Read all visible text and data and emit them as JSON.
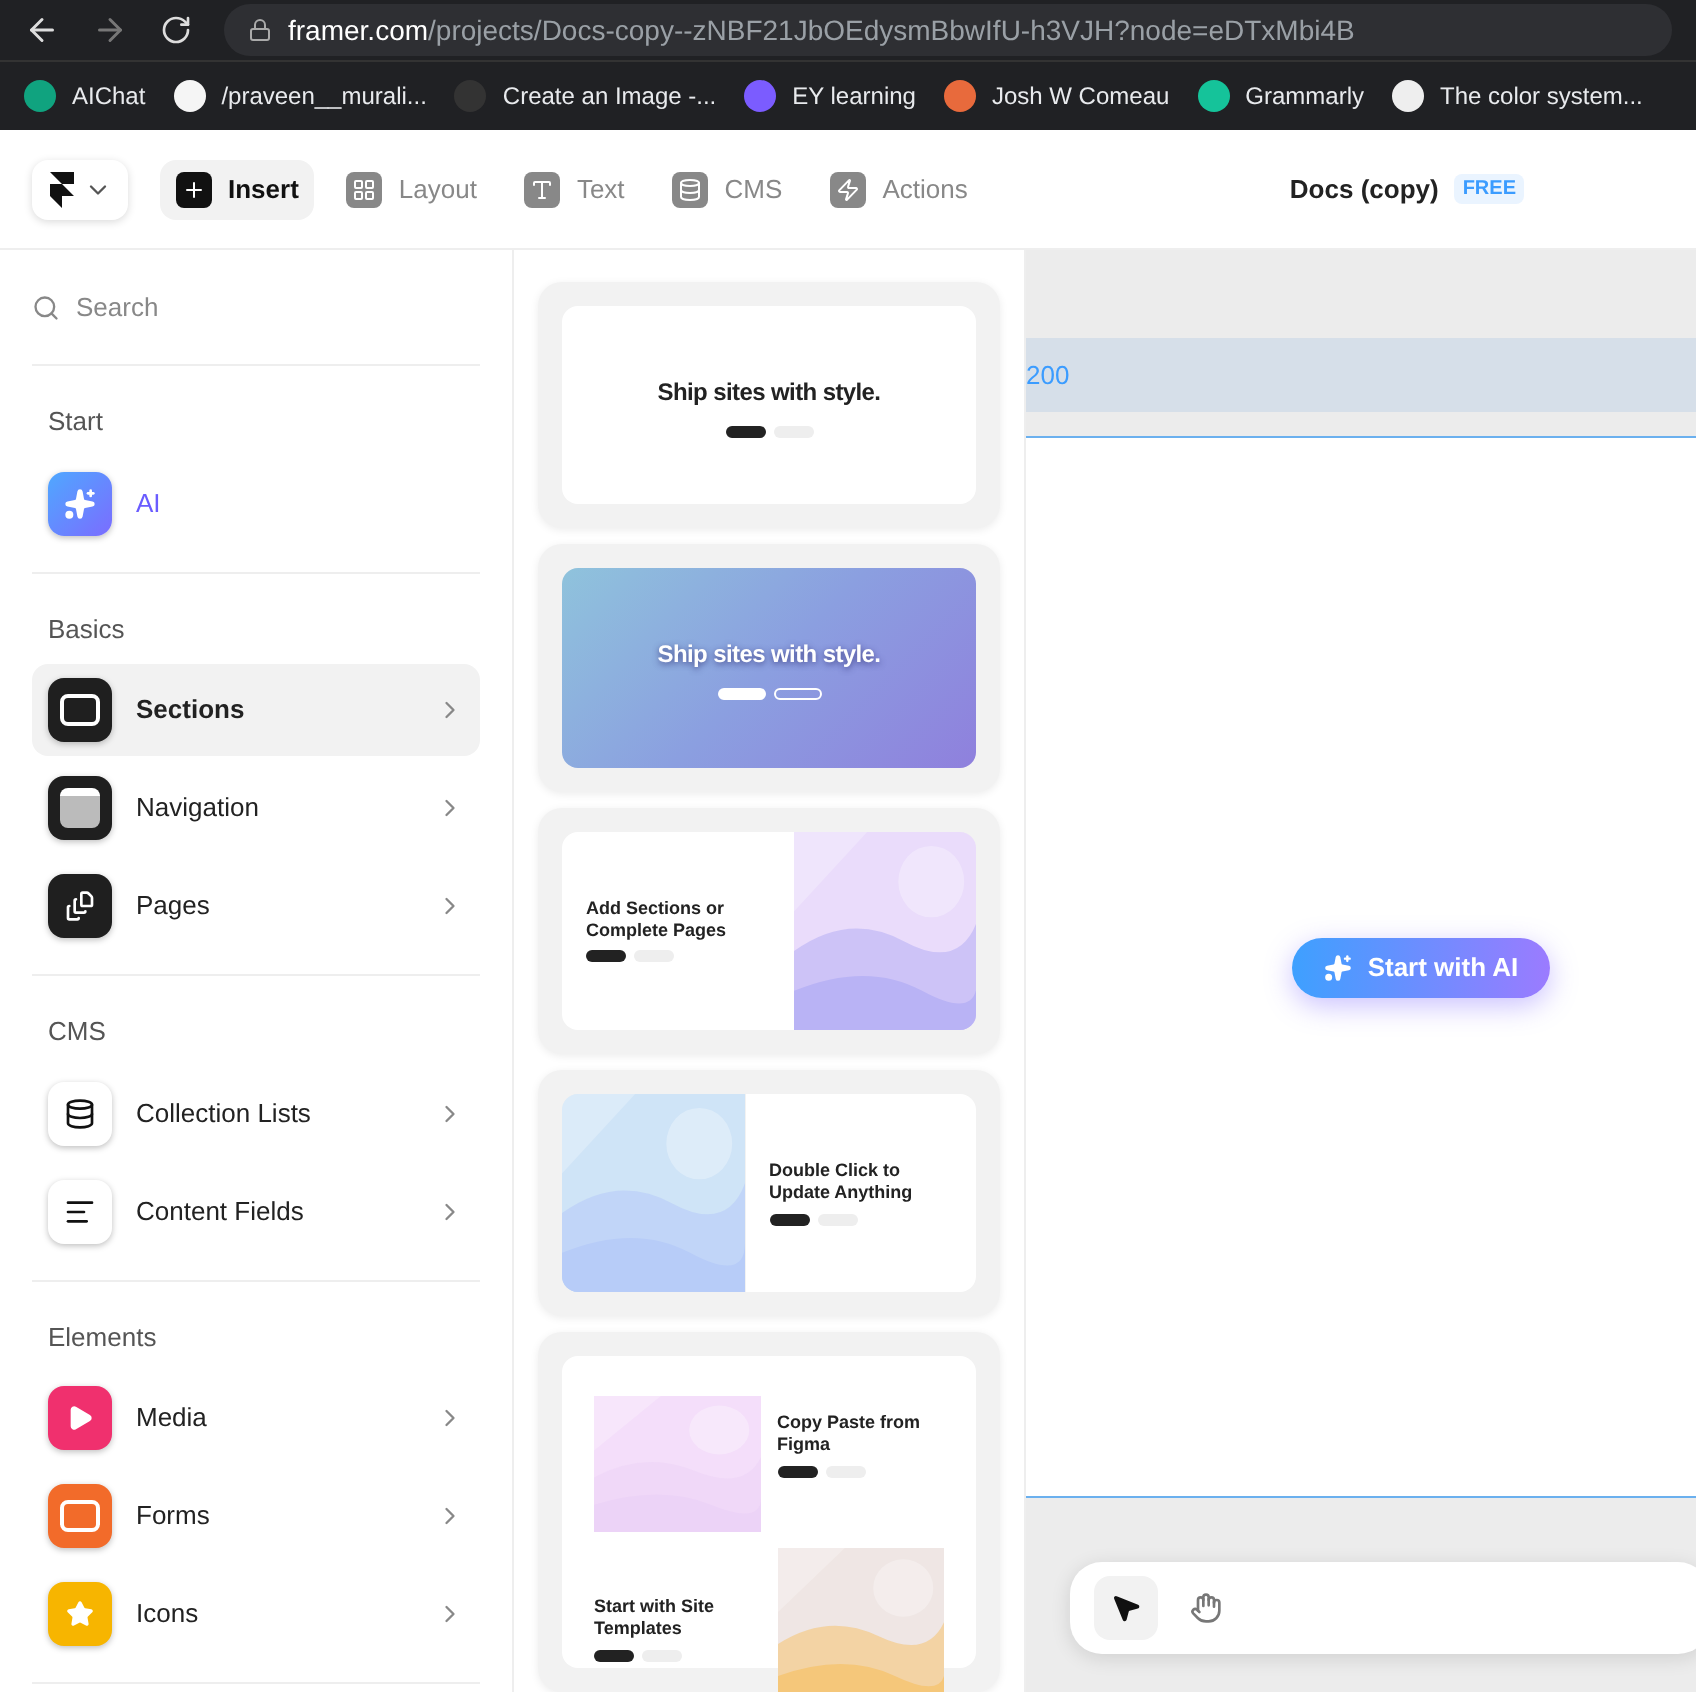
{
  "browser": {
    "url_host": "framer.com",
    "url_path": "/projects/Docs-copy--zNBF21JbOEdysmBbwIfU-h3VJH?node=eDTxMbi4B",
    "bookmarks": [
      {
        "label": "AIChat",
        "color": "#10a37f"
      },
      {
        "label": "/praveen__murali...",
        "color": "#f5f5f5"
      },
      {
        "label": "Create an Image -...",
        "color": "#333333"
      },
      {
        "label": "EY learning",
        "color": "#7b5cff"
      },
      {
        "label": "Josh W Comeau",
        "color": "#e86a3c"
      },
      {
        "label": "Grammarly",
        "color": "#15c39a"
      },
      {
        "label": "The color system...",
        "color": "#eeeeee"
      }
    ]
  },
  "toolbar": {
    "tabs": [
      {
        "label": "Insert",
        "selected": true
      },
      {
        "label": "Layout",
        "selected": false
      },
      {
        "label": "Text",
        "selected": false
      },
      {
        "label": "CMS",
        "selected": false
      },
      {
        "label": "Actions",
        "selected": false
      }
    ],
    "project": {
      "title": "Docs (copy)",
      "badge": "FREE"
    }
  },
  "sidebar": {
    "search": {
      "placeholder": "Search"
    },
    "groups": [
      {
        "heading": "Start",
        "items": [
          {
            "label": "AI",
            "color": "#7b6cff",
            "selected": false,
            "expandable": false,
            "accent": true
          }
        ]
      },
      {
        "heading": "Basics",
        "items": [
          {
            "label": "Sections",
            "color": "#1f1f1f",
            "selected": true,
            "expandable": true,
            "accent": false
          },
          {
            "label": "Navigation",
            "color": "#1f1f1f",
            "selected": false,
            "expandable": true,
            "accent": false
          },
          {
            "label": "Pages",
            "color": "#1f1f1f",
            "selected": false,
            "expandable": true,
            "accent": false
          }
        ]
      },
      {
        "heading": "CMS",
        "items": [
          {
            "label": "Collection Lists",
            "color": "#ffffff",
            "selected": false,
            "expandable": true,
            "accent": false
          },
          {
            "label": "Content Fields",
            "color": "#ffffff",
            "selected": false,
            "expandable": true,
            "accent": false
          }
        ]
      },
      {
        "heading": "Elements",
        "items": [
          {
            "label": "Media",
            "color": "#f0306e",
            "selected": false,
            "expandable": true,
            "accent": false
          },
          {
            "label": "Forms",
            "color": "#f26b2a",
            "selected": false,
            "expandable": true,
            "accent": false
          },
          {
            "label": "Icons",
            "color": "#f7b500",
            "selected": false,
            "expandable": true,
            "accent": false
          }
        ]
      }
    ]
  },
  "templates": [
    {
      "kind": "hero",
      "titles": [
        "Ship sites with style."
      ]
    },
    {
      "kind": "hero-gradient",
      "titles": [
        "Ship sites with style."
      ]
    },
    {
      "kind": "split-left",
      "titles": [
        "Add Sections or Complete Pages"
      ]
    },
    {
      "kind": "split-right",
      "titles": [
        "Double Click to Update Anything"
      ]
    },
    {
      "kind": "grid",
      "titles": [
        "Copy Paste from Figma",
        "Start with Site Templates"
      ]
    }
  ],
  "canvas": {
    "ruler_label": "200",
    "ai_button": "Start with AI",
    "tools": [
      {
        "kind": "pointer",
        "selected": true
      },
      {
        "kind": "hand",
        "selected": false
      }
    ]
  }
}
